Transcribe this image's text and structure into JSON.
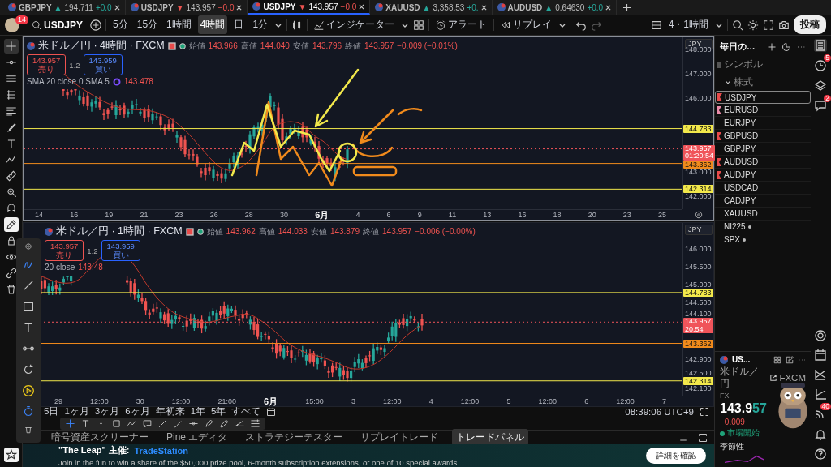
{
  "tabs": [
    {
      "symbol": "GBPJPY",
      "arrow": "▲",
      "price": "194.711",
      "change": "+0.0",
      "rising": true,
      "selected": false
    },
    {
      "symbol": "USDJPY",
      "arrow": "▼",
      "price": "143.957",
      "change": "−0.0",
      "rising": false,
      "selected": false
    },
    {
      "symbol": "USDJPY",
      "arrow": "▼",
      "price": "143.957",
      "change": "−0.0",
      "rising": false,
      "selected": true
    },
    {
      "symbol": "XAUUSD",
      "arrow": "▲",
      "price": "3,358.53",
      "change": "+0.",
      "rising": true,
      "selected": false
    },
    {
      "symbol": "AUDUSD",
      "arrow": "▲",
      "price": "0.64630",
      "change": "+0.0",
      "rising": true,
      "selected": false
    }
  ],
  "toolbar": {
    "avatar_badge": "14",
    "search": "USDJPY",
    "intervals": [
      {
        "label": "5分",
        "selected": false
      },
      {
        "label": "15分",
        "selected": false
      },
      {
        "label": "1時間",
        "selected": false
      },
      {
        "label": "4時間",
        "selected": true
      },
      {
        "label": "日",
        "selected": false
      },
      {
        "label": "1分",
        "selected": false
      }
    ],
    "indicators": "インジケーター",
    "alert": "アラート",
    "replay": "リプレイ",
    "layout": "4・1時間",
    "post": "投稿"
  },
  "charts": [
    {
      "title": "米ドル／円 · 4時間 · FXCM",
      "ohlc": [
        {
          "label": "始値",
          "value": "143.966"
        },
        {
          "label": "高値",
          "value": "144.040"
        },
        {
          "label": "安値",
          "value": "143.796"
        },
        {
          "label": "終値",
          "value": "143.957"
        }
      ],
      "change": "−0.009 (−0.01%)",
      "sell": {
        "price": "143.957",
        "label": "売り"
      },
      "spread": "1.2",
      "buy": {
        "price": "143.959",
        "label": "買い"
      },
      "indicator": "SMA 20 close 0 SMA 5",
      "indicator_value": "143.478",
      "currency": "JPY",
      "price_ticks": [
        "148.000",
        "147.000",
        "146.000",
        "143.000",
        "142.000"
      ],
      "price_tags": [
        {
          "value": "144.783",
          "color": "#f2e84b"
        },
        {
          "value": "143.957",
          "countdown": "01:20:54",
          "color": "#f0545a"
        },
        {
          "value": "143.362",
          "color": "#f08a1c"
        },
        {
          "value": "142.314",
          "color": "#f2e84b"
        }
      ],
      "time_ticks": [
        {
          "label": "14",
          "bold": false
        },
        {
          "label": "16",
          "bold": false
        },
        {
          "label": "19",
          "bold": false
        },
        {
          "label": "21",
          "bold": false
        },
        {
          "label": "23",
          "bold": false
        },
        {
          "label": "26",
          "bold": false
        },
        {
          "label": "28",
          "bold": false
        },
        {
          "label": "30",
          "bold": false
        },
        {
          "label": "6月",
          "bold": true
        },
        {
          "label": "4",
          "bold": false
        },
        {
          "label": "6",
          "bold": false
        },
        {
          "label": "9",
          "bold": false
        },
        {
          "label": "11",
          "bold": false
        },
        {
          "label": "13",
          "bold": false
        },
        {
          "label": "16",
          "bold": false
        },
        {
          "label": "18",
          "bold": false
        },
        {
          "label": "20",
          "bold": false
        },
        {
          "label": "23",
          "bold": false
        },
        {
          "label": "25",
          "bold": false
        }
      ]
    },
    {
      "title": "米ドル／円 · 1時間 · FXCM",
      "ohlc": [
        {
          "label": "始値",
          "value": "143.962"
        },
        {
          "label": "高値",
          "value": "144.033"
        },
        {
          "label": "安値",
          "value": "143.879"
        },
        {
          "label": "終値",
          "value": "143.957"
        }
      ],
      "change": "−0.006 (−0.00%)",
      "sell": {
        "price": "143.957",
        "label": "売り"
      },
      "spread": "1.2",
      "buy": {
        "price": "143.959",
        "label": "買い"
      },
      "indicator": "20 close",
      "indicator_value": "143.48",
      "currency": "JPY",
      "price_ticks": [
        "146.000",
        "145.500",
        "145.000",
        "144.500",
        "144.100",
        "142.900",
        "142.500",
        "142.100"
      ],
      "price_tags": [
        {
          "value": "144.783",
          "color": "#f2e84b"
        },
        {
          "value": "143.957",
          "countdown": "20:54",
          "color": "#f0545a"
        },
        {
          "value": "143.362",
          "color": "#f08a1c"
        },
        {
          "value": "142.314",
          "color": "#f2e84b"
        }
      ],
      "time_ticks": [
        {
          "label": "29",
          "bold": false
        },
        {
          "label": "12:00",
          "bold": false
        },
        {
          "label": "30",
          "bold": false
        },
        {
          "label": "12:00",
          "bold": false
        },
        {
          "label": "21:00",
          "bold": false
        },
        {
          "label": "6月",
          "bold": true
        },
        {
          "label": "15:00",
          "bold": false
        },
        {
          "label": "3",
          "bold": false
        },
        {
          "label": "12:00",
          "bold": false
        },
        {
          "label": "4",
          "bold": false
        },
        {
          "label": "12:00",
          "bold": false
        },
        {
          "label": "5",
          "bold": false
        },
        {
          "label": "12:00",
          "bold": false
        },
        {
          "label": "6",
          "bold": false
        },
        {
          "label": "12:00",
          "bold": false
        },
        {
          "label": "7",
          "bold": false
        }
      ]
    }
  ],
  "range_bar": {
    "ranges": [
      "5日",
      "1ヶ月",
      "3ヶ月",
      "6ヶ月",
      "年初来",
      "1年",
      "5年",
      "すべて"
    ],
    "clock": "08:39:06 UTC+9"
  },
  "bottom_panel": {
    "tabs": [
      {
        "label": "暗号資産スクリーナー",
        "selected": false
      },
      {
        "label": "Pine エディタ",
        "selected": false
      },
      {
        "label": "ストラテジーテスター",
        "selected": false
      },
      {
        "label": "リプレイトレード",
        "selected": false
      },
      {
        "label": "トレードパネル",
        "selected": true
      }
    ],
    "banner": {
      "title": "\"The Leap\" 主催:",
      "sponsor": "TradeStation",
      "text": "Join in the fun to win a share of the $50,000 prize pool, 6-month subscription extensions, or one of 10 special awards",
      "button": "詳細を確認"
    }
  },
  "watchlist": {
    "title": "毎日の…",
    "column": "シンボル",
    "section": {
      "label": "株式",
      "expanded": true
    },
    "items": [
      {
        "symbol": "USDJPY",
        "color": "#e84b4b",
        "dot": false,
        "selected": true
      },
      {
        "symbol": "EURUSD",
        "color": "#e98aa8",
        "dot": false,
        "selected": false
      },
      {
        "symbol": "EURJPY",
        "dot": false,
        "selected": false
      },
      {
        "symbol": "GBPUSD",
        "color": "#e84b4b",
        "dot": false,
        "selected": false
      },
      {
        "symbol": "GBPJPY",
        "dot": false,
        "selected": false
      },
      {
        "symbol": "AUDUSD",
        "color": "#e84b4b",
        "dot": false,
        "selected": false
      },
      {
        "symbol": "AUDJPY",
        "color": "#e84b4b",
        "dot": false,
        "selected": false
      },
      {
        "symbol": "USDCAD",
        "dot": false,
        "selected": false
      },
      {
        "symbol": "CADJPY",
        "dot": false,
        "selected": false
      },
      {
        "symbol": "XAUUSD",
        "dot": false,
        "selected": false
      },
      {
        "symbol": "NI225",
        "dot": true,
        "selected": false
      },
      {
        "symbol": "SPX",
        "dot": true,
        "selected": false
      }
    ]
  },
  "rail": {
    "alerts_badge": "5",
    "chat_badge": "2",
    "news_badge": "40"
  },
  "details": {
    "symbol": "US...",
    "name": "米ドル／円",
    "exchange": "FXCM",
    "type": "FX",
    "price": "143.9",
    "price_pips": "57",
    "change": "−0.009",
    "status": "市場開始",
    "section": "季節性"
  }
}
